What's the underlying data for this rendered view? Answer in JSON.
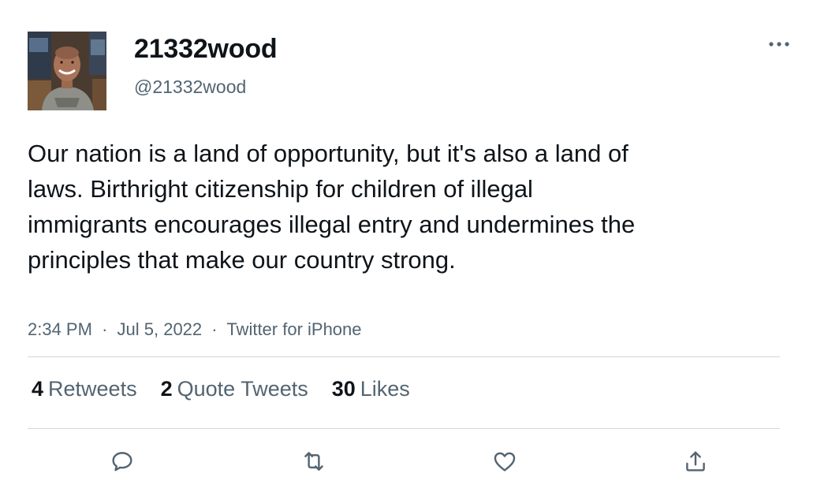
{
  "user": {
    "display_name": "21332wood",
    "handle": "@21332wood",
    "avatar_icon": "profile-photo"
  },
  "tweet": {
    "text": "Our nation is a land of opportunity, but it's also a land of laws. Birthright citizenship for children of illegal immigrants encourages illegal entry and undermines the principles that make our country strong.",
    "time": "2:34 PM",
    "date": "Jul 5, 2022",
    "source": "Twitter for iPhone",
    "separator": "·"
  },
  "stats": {
    "retweets_count": "4",
    "retweets_label": "Retweets",
    "quotes_count": "2",
    "quotes_label": "Quote Tweets",
    "likes_count": "30",
    "likes_label": "Likes"
  },
  "actions": [
    "reply-icon",
    "retweet-icon",
    "like-icon",
    "share-icon"
  ],
  "colors": {
    "text_primary": "#0f1419",
    "text_secondary": "#536471",
    "divider": "#cfd9de",
    "icon": "#536471"
  }
}
